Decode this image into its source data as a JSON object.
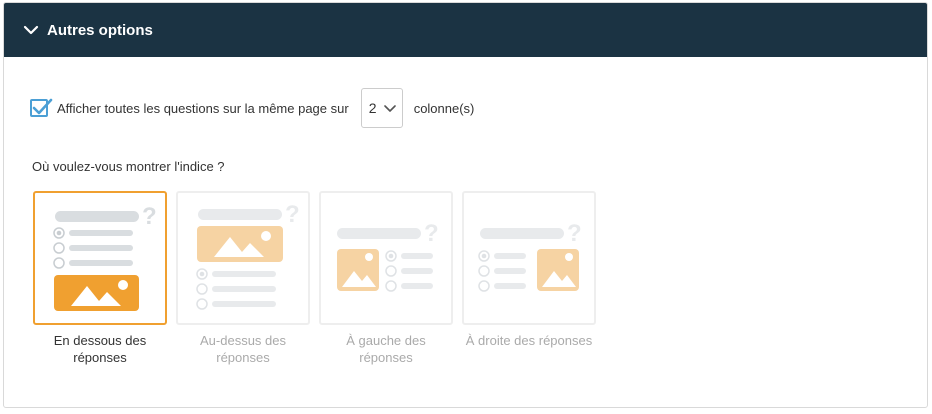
{
  "panel": {
    "title": "Autres options"
  },
  "display": {
    "checked": true,
    "label": "Afficher toutes les questions sur la même page sur",
    "columns_value": "2",
    "columns_suffix": "colonne(s)"
  },
  "hint": {
    "question": "Où voulez-vous montrer l'indice ?",
    "options": [
      {
        "label": "En dessous des réponses",
        "selected": true,
        "icon": "layout-image-below-icon"
      },
      {
        "label": "Au-dessus des réponses",
        "selected": false,
        "icon": "layout-image-above-icon"
      },
      {
        "label": "À gauche des réponses",
        "selected": false,
        "icon": "layout-image-left-icon"
      },
      {
        "label": "À droite des réponses",
        "selected": false,
        "icon": "layout-image-right-icon"
      }
    ]
  },
  "colors": {
    "header_bg": "#1b3343",
    "accent_orange": "#f0a030",
    "checkbox_blue": "#4b9fd5"
  }
}
